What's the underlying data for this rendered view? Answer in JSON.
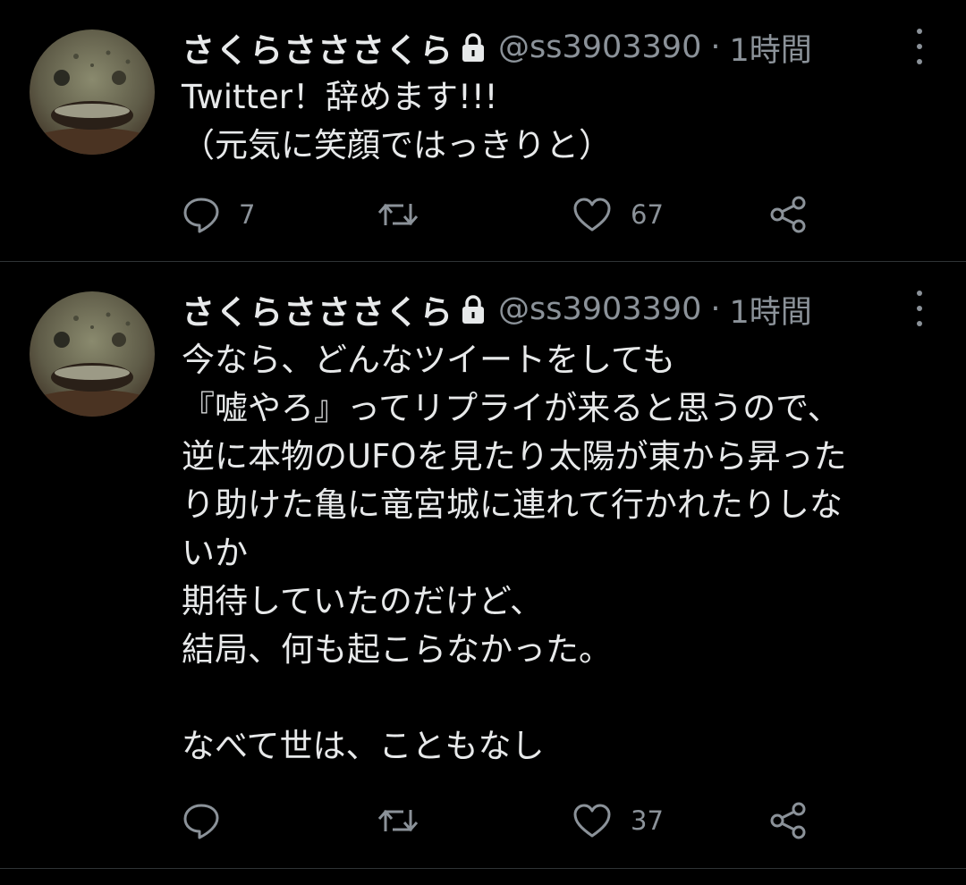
{
  "tweets": [
    {
      "display_name": "さくらさささくら",
      "handle": "@ss3903390",
      "separator": "·",
      "time": "1時間",
      "lines": [
        "Twitter！辞めます!!!",
        "（元気に笑顔ではっきりと）"
      ],
      "reply_count": "7",
      "retweet_count": "",
      "like_count": "67"
    },
    {
      "display_name": "さくらさささくら",
      "handle": "@ss3903390",
      "separator": "·",
      "time": "1時間",
      "lines": [
        "今なら、どんなツイートをしても",
        "『嘘やろ』ってリプライが来ると思うので、",
        "逆に本物のUFOを見たり太陽が東から昇った",
        "り助けた亀に竜宮城に連れて行かれたりしな",
        "いか",
        "期待していたのだけど、",
        "結局、何も起こらなかった。",
        "",
        "なべて世は、こともなし"
      ],
      "reply_count": "",
      "retweet_count": "",
      "like_count": "37"
    }
  ],
  "colors": {
    "background": "#000000",
    "text": "#e7e9ea",
    "secondary": "#8b9299",
    "divider": "#2f3336"
  },
  "icons": [
    "lock-icon",
    "more-icon",
    "reply-icon",
    "retweet-icon",
    "like-icon",
    "share-icon"
  ]
}
